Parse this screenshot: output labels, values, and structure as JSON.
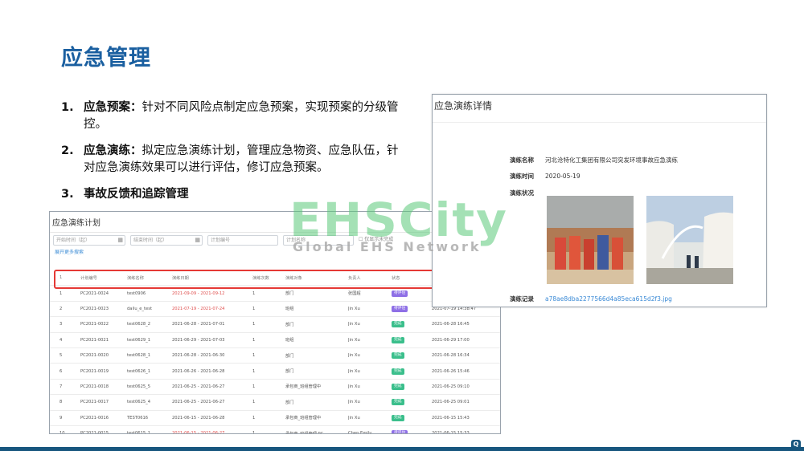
{
  "slide": {
    "title": "应急管理"
  },
  "points": [
    {
      "num": "1.",
      "head": "应急预案：",
      "body": "针对不同风险点制定应急预案，实现预案的分级管控。"
    },
    {
      "num": "2.",
      "head": "应急演练：",
      "body": "拟定应急演练计划，管理应急物资、应急队伍，针对应急演练效果可以进行评估，修订应急预案。"
    },
    {
      "num": "3.",
      "head": "事故反馈和追踪管理",
      "body": ""
    }
  ],
  "plan": {
    "title": "应急演练计划",
    "filters": [
      {
        "placeholder": "开始时间（起）",
        "icon": "calendar-icon"
      },
      {
        "placeholder": "结束时间（起）",
        "icon": "calendar-icon"
      },
      {
        "placeholder": "计划编号",
        "icon": ""
      },
      {
        "placeholder": "计划名称",
        "icon": ""
      }
    ],
    "checkbox_label": "仅显示未完成",
    "link": "展开更多搜索",
    "header_row": [
      "1",
      "计划编号",
      "演练名称",
      "演练日期",
      "演练次数",
      "演练对象",
      "负责人",
      "状态"
    ],
    "rows": [
      {
        "idx": "1",
        "code": "PC2021-0024",
        "name": "test0906",
        "date": "2021-09-09 - 2021-09-12",
        "red": true,
        "count": "1",
        "target": "部门",
        "person": "张国超",
        "status": "待评估",
        "status_color": "purple",
        "time": ""
      },
      {
        "idx": "2",
        "code": "PC2021-0023",
        "name": "dailu_e_test",
        "date": "2021-07-19 - 2021-07-24",
        "red": true,
        "count": "1",
        "target": "班组",
        "person": "Jin Xu",
        "status": "待评估",
        "status_color": "purple",
        "time": "2021-07-19 14:38:47"
      },
      {
        "idx": "3",
        "code": "PC2021-0022",
        "name": "test0628_2",
        "date": "2021-06-28 - 2021-07-01",
        "red": false,
        "count": "1",
        "target": "部门",
        "person": "Jin Xu",
        "status": "完成",
        "status_color": "green",
        "time": "2021-06-28 16:45"
      },
      {
        "idx": "4",
        "code": "PC2021-0021",
        "name": "test0629_1",
        "date": "2021-06-29 - 2021-07-03",
        "red": false,
        "count": "1",
        "target": "班组",
        "person": "Jin Xu",
        "status": "完成",
        "status_color": "green",
        "time": "2021-06-29 17:00"
      },
      {
        "idx": "5",
        "code": "PC2021-0020",
        "name": "test0628_1",
        "date": "2021-06-28 - 2021-06-30",
        "red": false,
        "count": "1",
        "target": "部门",
        "person": "Jin Xu",
        "status": "完成",
        "status_color": "green",
        "time": "2021-06-28 16:34"
      },
      {
        "idx": "6",
        "code": "PC2021-0019",
        "name": "test0626_1",
        "date": "2021-06-26 - 2021-06-28",
        "red": false,
        "count": "1",
        "target": "部门",
        "person": "Jin Xu",
        "status": "完成",
        "status_color": "green",
        "time": "2021-06-26 15:46"
      },
      {
        "idx": "7",
        "code": "PC2021-0018",
        "name": "test0625_5",
        "date": "2021-06-25 - 2021-06-27",
        "red": false,
        "count": "1",
        "target": "承包商_班组管理中",
        "person": "Jin Xu",
        "status": "完成",
        "status_color": "green",
        "time": "2021-06-25 09:10"
      },
      {
        "idx": "8",
        "code": "PC2021-0017",
        "name": "test0625_4",
        "date": "2021-06-25 - 2021-06-27",
        "red": false,
        "count": "1",
        "target": "部门",
        "person": "Jin Xu",
        "status": "完成",
        "status_color": "green",
        "time": "2021-06-25 09:01"
      },
      {
        "idx": "9",
        "code": "PC2021-0016",
        "name": "TEST0616",
        "date": "2021-06-15 - 2021-06-28",
        "red": false,
        "count": "1",
        "target": "承包商_班组管理中",
        "person": "Jin Xu",
        "status": "完成",
        "status_color": "green",
        "time": "2021-06-15 15:43"
      },
      {
        "idx": "10",
        "code": "PC2021-0015",
        "name": "test0615_1",
        "date": "2021-06-15 - 2021-06-27",
        "red": true,
        "count": "1",
        "target": "承包商_班组管理 PC",
        "person": "Chen Emily",
        "status": "待评估",
        "status_color": "purple",
        "time": "2021-06-15 15:33"
      }
    ]
  },
  "detail": {
    "title": "应急演练详情",
    "name_label": "演练名称",
    "name_value": "河北沧特化工集团有限公司突发环境事故应急演练",
    "time_label": "演练时间",
    "time_value": "2020-05-19",
    "status_label": "演练状况",
    "record_label": "演练记录",
    "record_value": "a78ae8dba2277566d4a85eca615d2f3.jpg"
  },
  "watermark": {
    "main": "EHSCity",
    "sub": "Global EHS Network"
  },
  "corner": {
    "glyph": "Q"
  }
}
